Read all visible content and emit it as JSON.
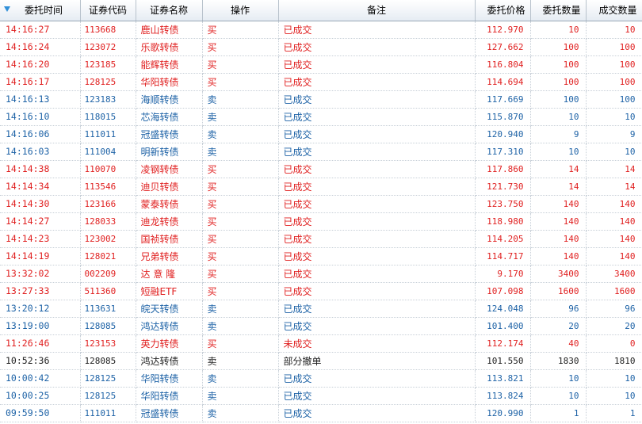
{
  "headers": {
    "time": "委托时间",
    "code": "证券代码",
    "name": "证券名称",
    "op": "操作",
    "note": "备注",
    "price": "委托价格",
    "qty": "委托数量",
    "deal": "成交数量"
  },
  "colors": {
    "buy": "#e02020",
    "sell": "#1d62a6",
    "neutral": "#222222"
  },
  "rows": [
    {
      "time": "14:16:27",
      "code": "113668",
      "name": "鹿山转债",
      "op": "买",
      "note": "已成交",
      "price": "112.970",
      "qty": "10",
      "deal": "10",
      "side": "buy"
    },
    {
      "time": "14:16:24",
      "code": "123072",
      "name": "乐歌转债",
      "op": "买",
      "note": "已成交",
      "price": "127.662",
      "qty": "100",
      "deal": "100",
      "side": "buy"
    },
    {
      "time": "14:16:20",
      "code": "123185",
      "name": "能辉转债",
      "op": "买",
      "note": "已成交",
      "price": "116.804",
      "qty": "100",
      "deal": "100",
      "side": "buy"
    },
    {
      "time": "14:16:17",
      "code": "128125",
      "name": "华阳转债",
      "op": "买",
      "note": "已成交",
      "price": "114.694",
      "qty": "100",
      "deal": "100",
      "side": "buy"
    },
    {
      "time": "14:16:13",
      "code": "123183",
      "name": "海顺转债",
      "op": "卖",
      "note": "已成交",
      "price": "117.669",
      "qty": "100",
      "deal": "100",
      "side": "sell"
    },
    {
      "time": "14:16:10",
      "code": "118015",
      "name": "芯海转债",
      "op": "卖",
      "note": "已成交",
      "price": "115.870",
      "qty": "10",
      "deal": "10",
      "side": "sell"
    },
    {
      "time": "14:16:06",
      "code": "111011",
      "name": "冠盛转债",
      "op": "卖",
      "note": "已成交",
      "price": "120.940",
      "qty": "9",
      "deal": "9",
      "side": "sell"
    },
    {
      "time": "14:16:03",
      "code": "111004",
      "name": "明新转债",
      "op": "卖",
      "note": "已成交",
      "price": "117.310",
      "qty": "10",
      "deal": "10",
      "side": "sell"
    },
    {
      "time": "14:14:38",
      "code": "110070",
      "name": "凌钢转债",
      "op": "买",
      "note": "已成交",
      "price": "117.860",
      "qty": "14",
      "deal": "14",
      "side": "buy"
    },
    {
      "time": "14:14:34",
      "code": "113546",
      "name": "迪贝转债",
      "op": "买",
      "note": "已成交",
      "price": "121.730",
      "qty": "14",
      "deal": "14",
      "side": "buy"
    },
    {
      "time": "14:14:30",
      "code": "123166",
      "name": "蒙泰转债",
      "op": "买",
      "note": "已成交",
      "price": "123.750",
      "qty": "140",
      "deal": "140",
      "side": "buy"
    },
    {
      "time": "14:14:27",
      "code": "128033",
      "name": "迪龙转债",
      "op": "买",
      "note": "已成交",
      "price": "118.980",
      "qty": "140",
      "deal": "140",
      "side": "buy"
    },
    {
      "time": "14:14:23",
      "code": "123002",
      "name": "国祯转债",
      "op": "买",
      "note": "已成交",
      "price": "114.205",
      "qty": "140",
      "deal": "140",
      "side": "buy"
    },
    {
      "time": "14:14:19",
      "code": "128021",
      "name": "兄弟转债",
      "op": "买",
      "note": "已成交",
      "price": "114.717",
      "qty": "140",
      "deal": "140",
      "side": "buy"
    },
    {
      "time": "13:32:02",
      "code": "002209",
      "name": "达 意 隆",
      "op": "买",
      "note": "已成交",
      "price": "9.170",
      "qty": "3400",
      "deal": "3400",
      "side": "buy"
    },
    {
      "time": "13:27:33",
      "code": "511360",
      "name": "短融ETF",
      "op": "买",
      "note": "已成交",
      "price": "107.098",
      "qty": "1600",
      "deal": "1600",
      "side": "buy"
    },
    {
      "time": "13:20:12",
      "code": "113631",
      "name": "皖天转债",
      "op": "卖",
      "note": "已成交",
      "price": "124.048",
      "qty": "96",
      "deal": "96",
      "side": "sell"
    },
    {
      "time": "13:19:00",
      "code": "128085",
      "name": "鸿达转债",
      "op": "卖",
      "note": "已成交",
      "price": "101.400",
      "qty": "20",
      "deal": "20",
      "side": "sell"
    },
    {
      "time": "11:26:46",
      "code": "123153",
      "name": "英力转债",
      "op": "买",
      "note": "未成交",
      "price": "112.174",
      "qty": "40",
      "deal": "0",
      "side": "buy"
    },
    {
      "time": "10:52:36",
      "code": "128085",
      "name": "鸿达转债",
      "op": "卖",
      "note": "部分撤单",
      "price": "101.550",
      "qty": "1830",
      "deal": "1810",
      "side": "neutral"
    },
    {
      "time": "10:00:42",
      "code": "128125",
      "name": "华阳转债",
      "op": "卖",
      "note": "已成交",
      "price": "113.821",
      "qty": "10",
      "deal": "10",
      "side": "sell"
    },
    {
      "time": "10:00:25",
      "code": "128125",
      "name": "华阳转债",
      "op": "卖",
      "note": "已成交",
      "price": "113.824",
      "qty": "10",
      "deal": "10",
      "side": "sell"
    },
    {
      "time": "09:59:50",
      "code": "111011",
      "name": "冠盛转债",
      "op": "卖",
      "note": "已成交",
      "price": "120.990",
      "qty": "1",
      "deal": "1",
      "side": "sell"
    }
  ]
}
